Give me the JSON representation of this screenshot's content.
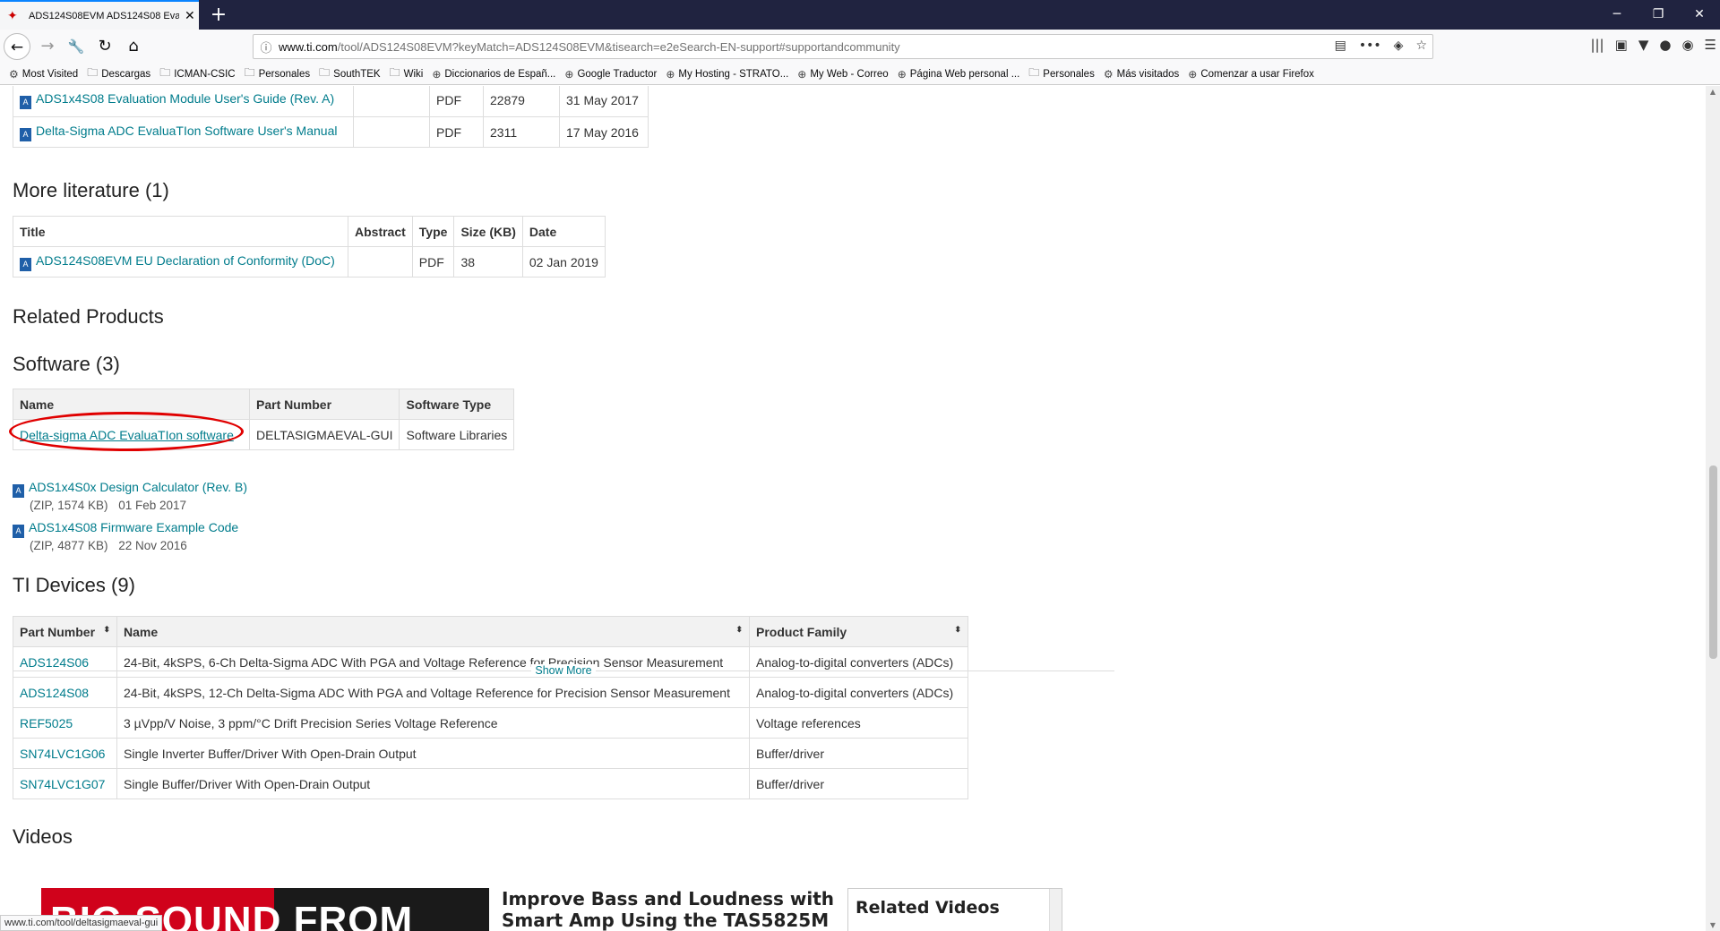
{
  "browser": {
    "tab_title": "ADS124S08EVM ADS124S08 Eva",
    "url_prefix": "www.ti.com",
    "url_rest": "/tool/ADS124S08EVM?keyMatch=ADS124S08EVM&tisearch=e2eSearch-EN-support#supportandcommunity",
    "bookmarks": [
      "Most Visited",
      "Descargas",
      "ICMAN-CSIC",
      "Personales",
      "SouthTEK",
      "Wiki",
      "Diccionarios de Españ...",
      "Google Traductor",
      "My Hosting - STRATO...",
      "My Web - Correo",
      "Página Web personal ...",
      "Personales",
      "Más visitados",
      "Comenzar a usar Firefox"
    ],
    "status_url": "www.ti.com/tool/deltasigmaeval-gui"
  },
  "top_docs": [
    {
      "title": "ADS1x4S08 Evaluation Module User's Guide (Rev. A)",
      "type": "PDF",
      "size": "22879",
      "date": "31 May 2017"
    },
    {
      "title": "Delta-Sigma ADC EvaluaTIon Software User's Manual",
      "type": "PDF",
      "size": "2311",
      "date": "17 May 2016"
    }
  ],
  "more_literature": {
    "heading": "More literature (1)",
    "headers": [
      "Title",
      "Abstract",
      "Type",
      "Size (KB)",
      "Date"
    ],
    "rows": [
      {
        "title": "ADS124S08EVM EU Declaration of Conformity (DoC)",
        "type": "PDF",
        "size": "38",
        "date": "02 Jan 2019"
      }
    ]
  },
  "related_products": {
    "heading": "Related Products"
  },
  "software": {
    "heading": "Software (3)",
    "headers": [
      "Name",
      "Part Number",
      "Software Type"
    ],
    "rows": [
      {
        "name": "Delta-sigma ADC EvaluaTIon software",
        "part": "DELTASIGMAEVAL-GUI",
        "type": "Software Libraries"
      }
    ],
    "downloads": [
      {
        "title": "ADS1x4S0x Design Calculator (Rev. B)",
        "meta": "(ZIP, 1574 KB)",
        "date": "01 Feb 2017"
      },
      {
        "title": "ADS1x4S08 Firmware Example Code",
        "meta": "(ZIP, 4877 KB)",
        "date": "22 Nov 2016"
      }
    ]
  },
  "ti_devices": {
    "heading": "TI Devices (9)",
    "headers": [
      "Part Number",
      "Name",
      "Product Family"
    ],
    "rows": [
      {
        "part": "ADS124S06",
        "name": "24-Bit, 4kSPS, 6-Ch Delta-Sigma ADC With PGA and Voltage Reference for Precision Sensor Measurement",
        "family": "Analog-to-digital converters (ADCs)"
      },
      {
        "part": "ADS124S08",
        "name": "24-Bit, 4kSPS, 12-Ch Delta-Sigma ADC With PGA and Voltage Reference for Precision Sensor Measurement",
        "family": "Analog-to-digital converters (ADCs)"
      },
      {
        "part": "REF5025",
        "name": "3 µVpp/V Noise, 3 ppm/°C Drift Precision Series Voltage Reference",
        "family": "Voltage references"
      },
      {
        "part": "SN74LVC1G06",
        "name": "Single Inverter Buffer/Driver With Open-Drain Output",
        "family": "Buffer/driver"
      },
      {
        "part": "SN74LVC1G07",
        "name": "Single Buffer/Driver With Open-Drain Output",
        "family": "Buffer/driver"
      }
    ],
    "show_more": "Show More"
  },
  "videos": {
    "heading": "Videos",
    "thumb_text": "BIG SOUND FROM",
    "title_line1": "Improve Bass and Loudness with",
    "title_line2": "Smart Amp Using the TAS5825M",
    "related_heading": "Related Videos"
  },
  "colors": {
    "link": "#007c8c",
    "highlight_circle": "#e00000",
    "tabbar": "#202340"
  }
}
